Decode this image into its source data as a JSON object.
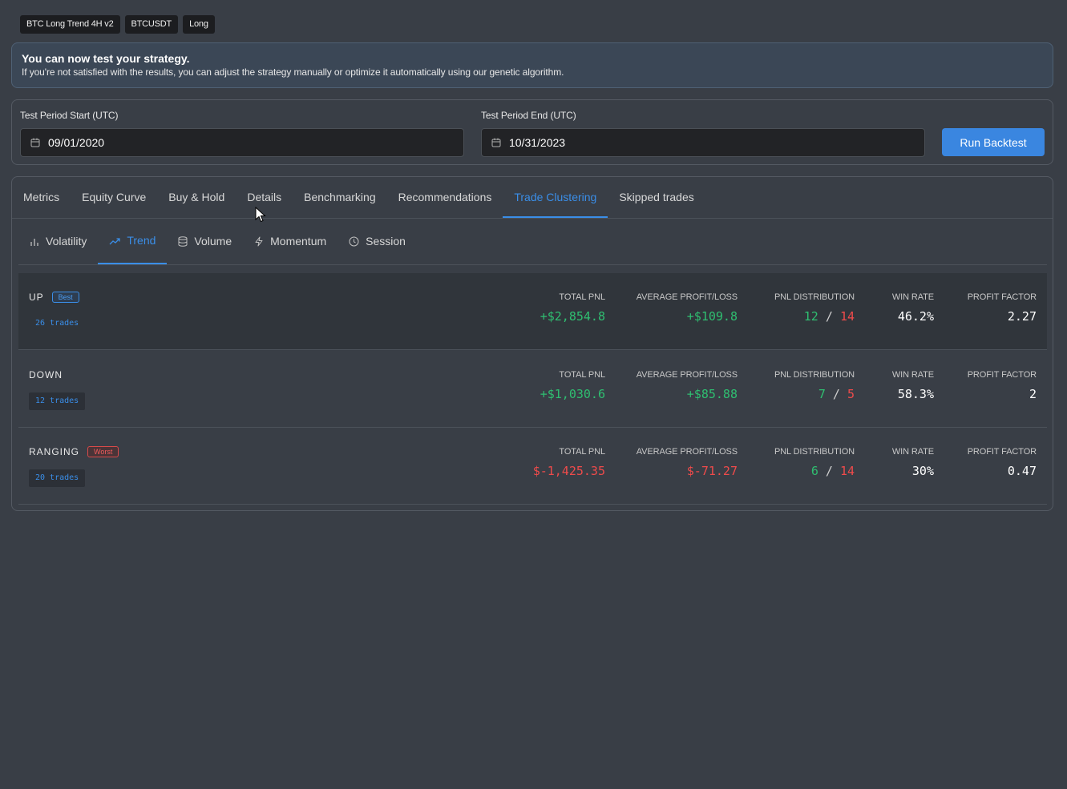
{
  "tags": [
    "BTC Long Trend 4H v2",
    "BTCUSDT",
    "Long"
  ],
  "banner": {
    "title": "You can now test your strategy.",
    "text": "If you're not satisfied with the results, you can adjust the strategy manually or optimize it automatically using our genetic algorithm."
  },
  "period": {
    "start_label": "Test Period Start (UTC)",
    "start_value": "09/01/2020",
    "end_label": "Test Period End (UTC)",
    "end_value": "10/31/2023",
    "run_label": "Run Backtest"
  },
  "main_tabs": [
    "Metrics",
    "Equity Curve",
    "Buy & Hold",
    "Details",
    "Benchmarking",
    "Recommendations",
    "Trade Clustering",
    "Skipped trades"
  ],
  "main_tab_active": "Trade Clustering",
  "sub_tabs": [
    {
      "label": "Volatility",
      "icon": "bar-chart-icon"
    },
    {
      "label": "Trend",
      "icon": "trend-up-icon"
    },
    {
      "label": "Volume",
      "icon": "database-icon"
    },
    {
      "label": "Momentum",
      "icon": "lightning-icon"
    },
    {
      "label": "Session",
      "icon": "clock-icon"
    }
  ],
  "sub_tab_active": "Trend",
  "metric_labels": {
    "total_pnl": "TOTAL PNL",
    "avg_pl": "AVERAGE PROFIT/LOSS",
    "pnl_dist": "PNL DISTRIBUTION",
    "win_rate": "WIN RATE",
    "profit_factor": "PROFIT FACTOR"
  },
  "clusters": [
    {
      "name": "UP",
      "badge": "Best",
      "trades": "26 trades",
      "total_pnl": "+$2,854.8",
      "avg_pl": "+$109.8",
      "wins": "12",
      "sep": "/",
      "losses": "14",
      "win_rate": "46.2%",
      "profit_factor": "2.27"
    },
    {
      "name": "DOWN",
      "badge": "",
      "trades": "12 trades",
      "total_pnl": "+$1,030.6",
      "avg_pl": "+$85.88",
      "wins": "7",
      "sep": "/",
      "losses": "5",
      "win_rate": "58.3%",
      "profit_factor": "2"
    },
    {
      "name": "RANGING",
      "badge": "Worst",
      "trades": "20 trades",
      "total_pnl": "$-1,425.35",
      "avg_pl": "$-71.27",
      "wins": "6",
      "sep": "/",
      "losses": "14",
      "win_rate": "30%",
      "profit_factor": "0.47"
    }
  ],
  "colors": {
    "accent": "#3a8ee8",
    "positive": "#2fbf71",
    "negative": "#ef4b4b",
    "background": "#393e46"
  }
}
